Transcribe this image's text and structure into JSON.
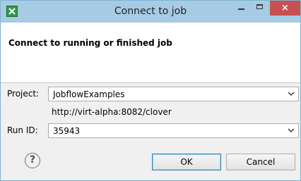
{
  "window": {
    "title": "Connect to job",
    "icons": {
      "app": "app-icon",
      "minimize": "minimize-icon",
      "maximize": "maximize-icon",
      "close": "close-icon"
    },
    "close_glyph": "×"
  },
  "header": {
    "title": "Connect to running or finished job"
  },
  "form": {
    "project_label": "Project:",
    "project_value": "JobflowExamples",
    "server_url": "http://virt-alpha:8082/clover",
    "runid_label": "Run ID:",
    "runid_value": "35943"
  },
  "footer": {
    "help_glyph": "?",
    "ok_label": "OK",
    "cancel_label": "Cancel"
  },
  "colors": {
    "titlebar": "#a6cbe4",
    "close_button": "#c75050",
    "dialog_bg": "#f0f0f0"
  }
}
